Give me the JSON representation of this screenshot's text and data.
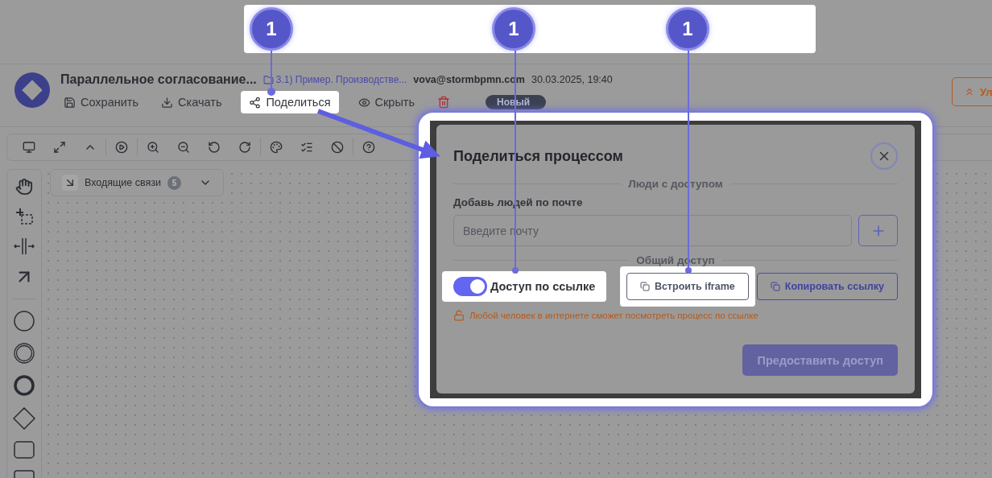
{
  "callouts": [
    {
      "label": "1"
    },
    {
      "label": "1"
    },
    {
      "label": "1"
    }
  ],
  "header": {
    "title": "Параллельное согласование...",
    "folder": "3.1) Пример. Производстве...",
    "user": "vova@stormbpmn.com",
    "date": "30.03.2025, 19:40",
    "status": "Новый",
    "right_button": "Ул"
  },
  "actions": [
    {
      "kind": "save",
      "label": "Сохранить",
      "highlighted": false
    },
    {
      "kind": "download",
      "label": "Скачать",
      "highlighted": false
    },
    {
      "kind": "share",
      "label": "Поделиться",
      "highlighted": true
    },
    {
      "kind": "hide",
      "label": "Скрыть",
      "highlighted": false
    },
    {
      "kind": "delete",
      "highlighted": false
    }
  ],
  "filter": {
    "label": "Входящие связи",
    "count": "5"
  },
  "dialog": {
    "title": "Поделиться процессом",
    "people_section": "Люди с доступом",
    "email_label": "Добавь людей по почте",
    "email_placeholder": "Введите почту",
    "public_section": "Общий доступ",
    "link_toggle": {
      "label": "Доступ по ссылке",
      "on": true,
      "highlighted": true
    },
    "buttons": [
      {
        "kind": "embed",
        "label": "Встроить iframe",
        "highlighted": true
      },
      {
        "kind": "copy",
        "label": "Копировать ссылку",
        "highlighted": false
      }
    ],
    "warning": "Любой человек в интернете сможет посмотреть процесс по ссылке",
    "submit": "Предоставить доступ"
  }
}
